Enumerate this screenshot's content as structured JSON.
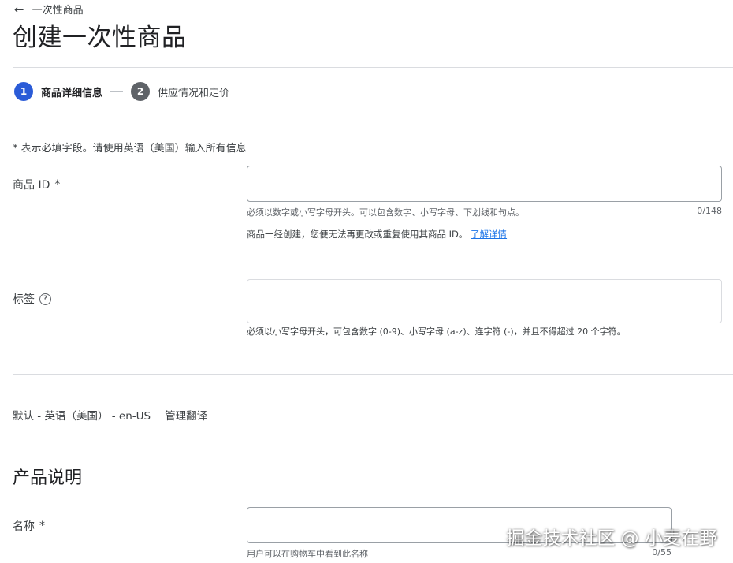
{
  "header": {
    "back_label": "一次性商品",
    "title": "创建一次性商品"
  },
  "stepper": {
    "steps": [
      {
        "number": "1",
        "label": "商品详细信息"
      },
      {
        "number": "2",
        "label": "供应情况和定价"
      }
    ]
  },
  "form": {
    "required_note": "* 表示必填字段。请使用英语（美国）输入所有信息",
    "product_id": {
      "label": "商品 ID",
      "required_mark": "*",
      "value": "",
      "helper": "必须以数字或小写字母开头。可以包含数字、小写字母、下划线和句点。",
      "counter": "0/148",
      "info": "商品一经创建，您便无法再更改或重复使用其商品 ID。",
      "learn_more": "了解详情"
    },
    "tags": {
      "label": "标签",
      "help_icon_glyph": "?",
      "value": "",
      "helper": "必须以小写字母开头，可包含数字 (0-9)、小写字母 (a-z)、连字符 (-)，并且不得超过 20 个字符。"
    }
  },
  "language": {
    "default_label": "默认 - 英语（美国） - en-US",
    "manage_translations": "管理翻译"
  },
  "description_section": {
    "title": "产品说明",
    "name": {
      "label": "名称",
      "required_mark": "*",
      "value": "",
      "helper": "用户可以在购物车中看到此名称",
      "counter": "0/55"
    }
  },
  "watermark": "掘金技术社区 @ 小麦在野",
  "colors": {
    "accent": "#2a5bd7",
    "link": "#1a73e8",
    "divider": "#dadce0",
    "input_border": "#9aa0a6"
  }
}
